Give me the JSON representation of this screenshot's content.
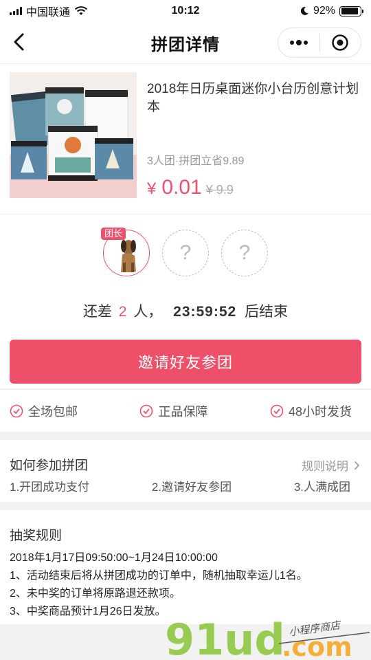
{
  "status_bar": {
    "carrier": "中国联通",
    "time": "10:12",
    "battery": "92%",
    "battery_level": 0.92
  },
  "nav": {
    "title": "拼团详情"
  },
  "product": {
    "name": "2018年日历桌面迷你小台历创意计划本",
    "tag": "3人团·拼团立省9.89",
    "currency": "¥",
    "price": "0.01",
    "original_price": "¥ 9.9"
  },
  "group": {
    "leader_badge": "团长",
    "empty_slot_mark": "?",
    "countdown_prefix": "还差",
    "needed": "2",
    "countdown_unit": "人，",
    "timer": "23:59:52",
    "countdown_suffix": "后结束",
    "invite_label": "邀请好友参团"
  },
  "guarantees": [
    "全场包邮",
    "正品保障",
    "48小时发货"
  ],
  "howto": {
    "title": "如何参加拼团",
    "rules_link": "规则说明",
    "steps": [
      "1.开团成功支付",
      "2.邀请好友参团",
      "3.人满成团"
    ]
  },
  "lottery": {
    "title": "抽奖规则",
    "lines": [
      "2018年1月17日09:50:00~1月24日10:00:00",
      "1、活动结束后将从拼团成功的订单中，随机抽取幸运儿1名。",
      "2、未中奖的订单将原路退还款项。",
      "3、中奖商品预计1月26日发放。"
    ]
  },
  "watermark": {
    "brand": "91ud",
    "domain": ".com",
    "tagline": "小程序商店"
  },
  "colors": {
    "accent": "#f0506e",
    "button": "#ef5069",
    "watermark_green": "#8dc63f",
    "watermark_orange": "#f5a623"
  }
}
